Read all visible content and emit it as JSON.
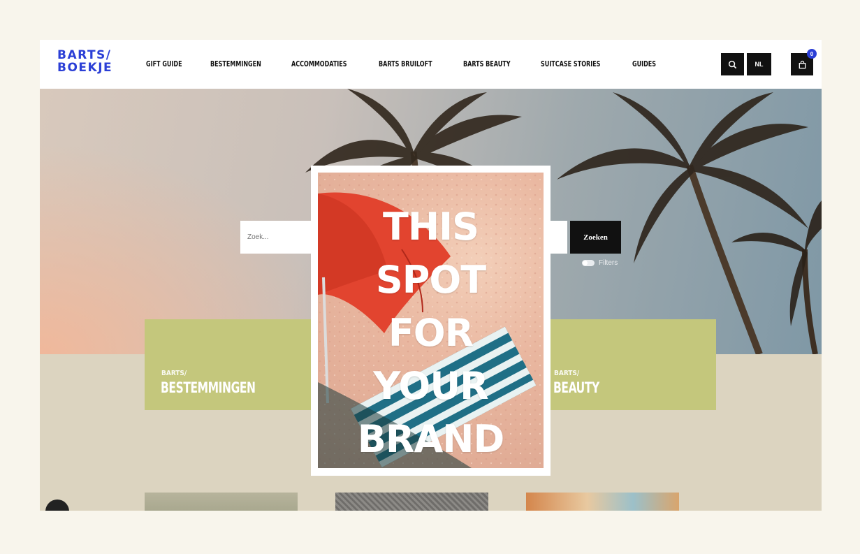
{
  "header": {
    "logo_line1": "BARTS/",
    "logo_line2": "BOEKJE",
    "nav": [
      "GIFT GUIDE",
      "BESTEMMINGEN",
      "ACCOMMODATIES",
      "BARTS BRUILOFT",
      "BARTS BEAUTY",
      "SUITCASE STORIES",
      "GUIDES"
    ],
    "lang_label": "NL",
    "cart_count": "0"
  },
  "search": {
    "placeholder": "Zoek...",
    "button_label": "Zoeken",
    "filters_label": "Filters"
  },
  "cards": [
    {
      "small": "BARTS/",
      "big": "BESTEMMINGEN"
    },
    {
      "small": "BARTS/",
      "big": "BEAUTY"
    }
  ],
  "ad": {
    "lines": [
      "THIS",
      "SPOT",
      "FOR",
      "YOUR",
      "BRAND"
    ]
  },
  "colors": {
    "brand_blue": "#2b3fd6",
    "card_green": "#c4c77c",
    "page_bg": "#f8f5ec"
  }
}
